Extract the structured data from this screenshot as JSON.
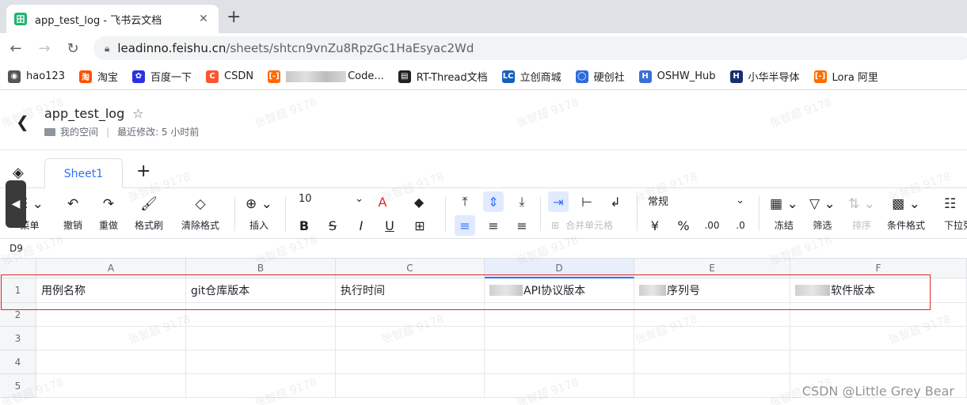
{
  "browser": {
    "tab_title": "app_test_log - 飞书云文档",
    "tab_favicon": "田",
    "url_host": "leadinno.feishu.cn",
    "url_path": "/sheets/shtcn9vnZu8RpzGc1HaEsyac2Wd"
  },
  "bookmarks": [
    {
      "label": "hao123",
      "icon": "globe-icon",
      "color": "#555555",
      "glyph": "◉"
    },
    {
      "label": "淘宝",
      "icon": "taobao-icon",
      "color": "#ff5000",
      "glyph": "淘"
    },
    {
      "label": "百度一下",
      "icon": "baidu-icon",
      "color": "#2932e1",
      "glyph": "✿"
    },
    {
      "label": "CSDN",
      "icon": "csdn-icon",
      "color": "#fc5531",
      "glyph": "C"
    },
    {
      "label": "Code...",
      "icon": "aliyun-icon",
      "color": "#ff6a00",
      "glyph": "[-]",
      "blurred": true
    },
    {
      "label": "RT-Thread文档",
      "icon": "book-icon",
      "color": "#222222",
      "glyph": "▤"
    },
    {
      "label": "立创商城",
      "icon": "lc-icon",
      "color": "#1560bd",
      "glyph": "LC"
    },
    {
      "label": "硬创社",
      "icon": "github-icon",
      "color": "#2b6de0",
      "glyph": "◯"
    },
    {
      "label": "OSHW_Hub",
      "icon": "oshw-icon",
      "color": "#3d6fd8",
      "glyph": "H"
    },
    {
      "label": "小华半导体",
      "icon": "hdsc-icon",
      "color": "#1a2f6e",
      "glyph": "H"
    },
    {
      "label": "Lora 阿里",
      "icon": "aliyun-icon",
      "color": "#ff6a00",
      "glyph": "[-]"
    }
  ],
  "doc": {
    "title": "app_test_log",
    "location": "我的空间",
    "modified": "最近修改: 5 小时前"
  },
  "sheet_tab": "Sheet1",
  "toolbar": {
    "menu": "菜单",
    "undo": "撤销",
    "redo": "重做",
    "format_painter": "格式刷",
    "clear_format": "清除格式",
    "insert": "插入",
    "font_size": "10",
    "merge_cells": "合并单元格",
    "number_format": "常规",
    "freeze": "冻结",
    "filter": "筛选",
    "sort": "排序",
    "conditional_format": "条件格式",
    "dropdown_list": "下拉列"
  },
  "cell_ref": "D9",
  "columns": [
    "A",
    "B",
    "C",
    "D",
    "E",
    "F"
  ],
  "rows": [
    "1",
    "2",
    "3",
    "4",
    "5"
  ],
  "row1": {
    "A": "用例名称",
    "B": "git仓库版本",
    "C": "执行时间",
    "D": "API协议版本",
    "E": "序列号",
    "F": "软件版本"
  },
  "watermark": "张智超 9178",
  "credit": "CSDN @Little Grey Bear"
}
